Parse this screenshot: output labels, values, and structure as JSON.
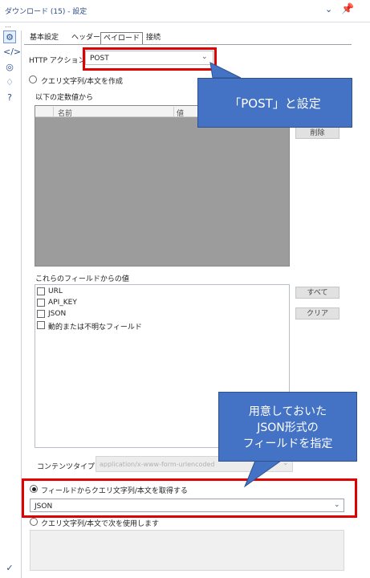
{
  "window": {
    "title": "ダウンロード (15) - 設定"
  },
  "tabs": [
    {
      "label": "基本設定"
    },
    {
      "label": "ヘッダー"
    },
    {
      "label": "ペイロード",
      "selected": true
    },
    {
      "label": "接続"
    }
  ],
  "http_action": {
    "label": "HTTP アクション",
    "value": "POST"
  },
  "query_option": {
    "label": "クエリ文字列/本文を作成",
    "selected": false
  },
  "constants": {
    "label": "以下の定数値から",
    "columns": [
      "名前",
      "値"
    ],
    "delete_label": "削除"
  },
  "fields": {
    "label": "これらのフィールドからの値",
    "items": [
      {
        "label": "URL",
        "checked": false
      },
      {
        "label": "API_KEY",
        "checked": false
      },
      {
        "label": "JSON",
        "checked": false
      },
      {
        "label": "動的または不明なフィールド",
        "checked": false
      }
    ],
    "all_label": "すべて",
    "clear_label": "クリア"
  },
  "content_type": {
    "label": "コンテンツタイプ",
    "value": "application/x-www-form-urlencoded",
    "disabled": true
  },
  "from_field_option": {
    "label": "フィールドからクエリ文字列/本文を取得する",
    "selected": true,
    "value": "JSON"
  },
  "use_body_option": {
    "label": "クエリ文字列/本文で次を使用します",
    "selected": false
  },
  "annotations": {
    "callout1": "「POST」と設定",
    "callout2": "用意しておいた\nJSON形式の\nフィールドを指定",
    "highlight_color": "#e00000",
    "callout_color": "#4472c4"
  },
  "icons": [
    "gear-icon",
    "code-icon",
    "target-icon",
    "tag-icon",
    "help-icon",
    "check-circle-icon",
    "chevron-down-icon",
    "pin-icon"
  ]
}
